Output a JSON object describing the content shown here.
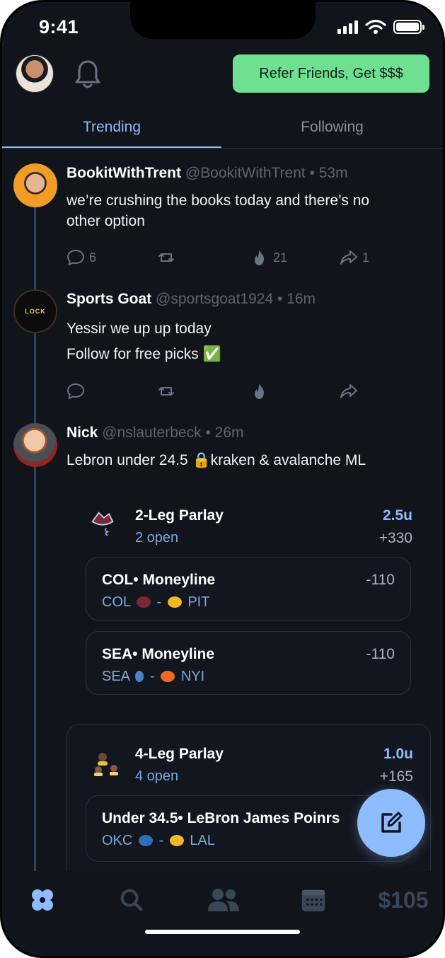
{
  "status": {
    "time": "9:41"
  },
  "header": {
    "refer_label": "Refer Friends, Get $$$"
  },
  "tabs": [
    {
      "label": "Trending",
      "active": true
    },
    {
      "label": "Following",
      "active": false
    }
  ],
  "posts": [
    {
      "name": "BookitWithTrent",
      "handle": "@BookitWithTrent",
      "time": "53m",
      "lines": [
        "we’re crushing the books today and there’s no",
        "other option"
      ],
      "replies": "6",
      "fires": "21",
      "shares": "1"
    },
    {
      "name": "Sports Goat",
      "handle": "@sportsgoat1924",
      "time": "16m",
      "lines": [
        "Yessir we up up today",
        "Follow for free picks ✅"
      ],
      "avatar_text": "LOCK",
      "replies": "",
      "fires": "",
      "shares": ""
    },
    {
      "name": "Nick",
      "handle": "@nslauterbeck",
      "time": "26m",
      "lines": [
        "Lebron under 24.5 🔒kraken & avalanche ML"
      ]
    }
  ],
  "parlays": [
    {
      "title": "2-Leg Parlay",
      "open": "2 open",
      "units": "2.5u",
      "odds": "+330",
      "legs": [
        {
          "title": "COL• Moneyline",
          "odds": "-110",
          "team1": "COL",
          "team2": "PIT"
        },
        {
          "title": "SEA• Moneyline",
          "odds": "-110",
          "team1": "SEA",
          "team2": "NYI"
        }
      ]
    },
    {
      "title": "4-Leg Parlay",
      "open": "4 open",
      "units": "1.0u",
      "odds": "+165",
      "legs": [
        {
          "title": "Under 34.5• LeBron James Poinrs",
          "team1": "OKC",
          "team2": "LAL"
        }
      ]
    }
  ],
  "tabbar": {
    "balance": "$105"
  },
  "colors": {
    "accent": "#8ebcff",
    "refer": "#6fe08f",
    "background": "#11141b"
  },
  "icons": [
    "bell-icon",
    "reply-icon",
    "repost-icon",
    "fire-icon",
    "share-icon",
    "compose-icon",
    "clover-icon",
    "search-icon",
    "people-icon",
    "calendar-icon"
  ]
}
